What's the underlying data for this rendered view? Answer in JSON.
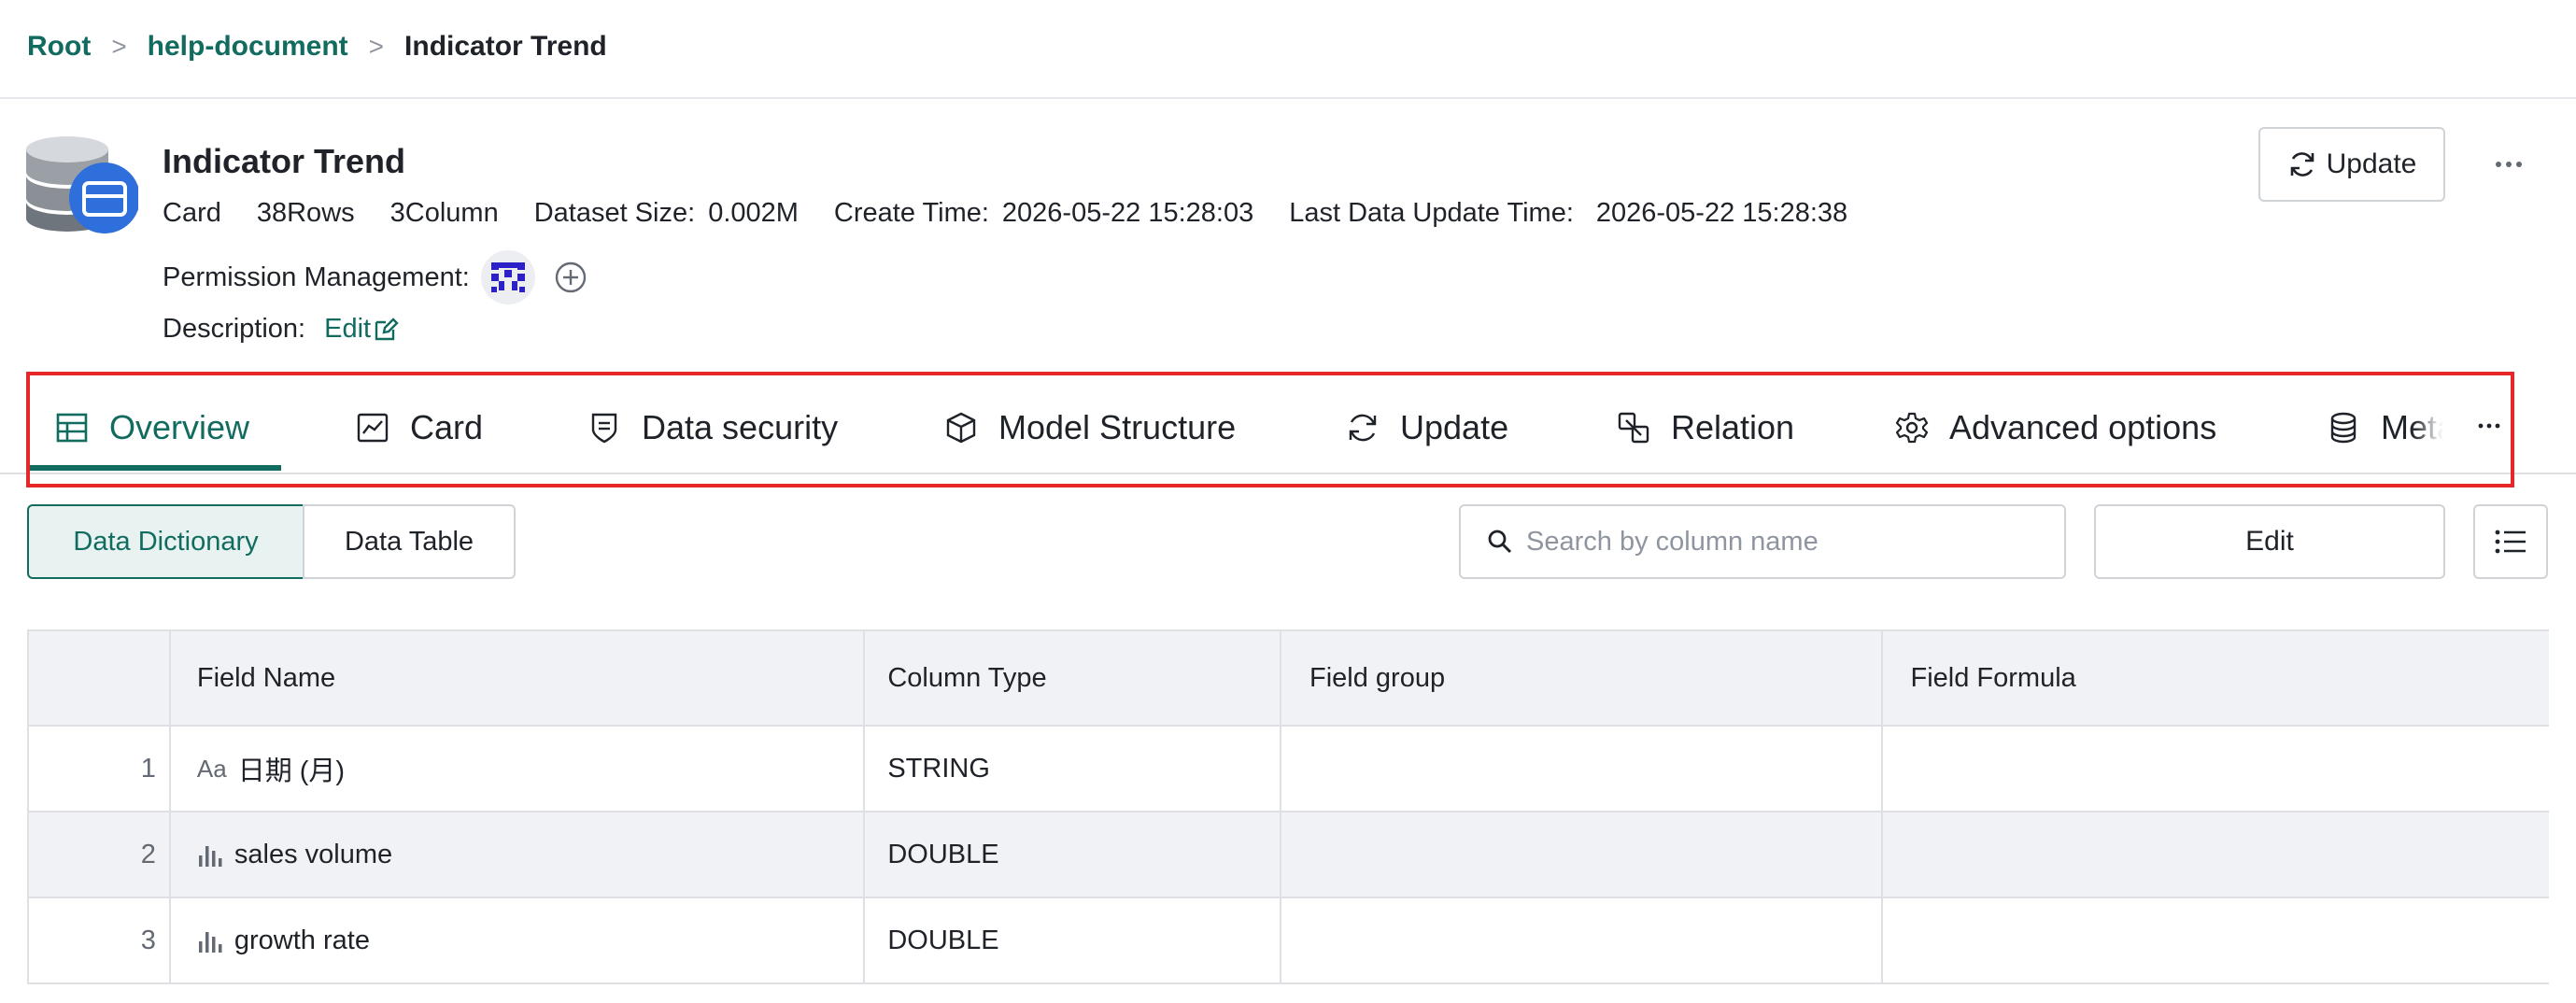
{
  "breadcrumb": {
    "root": "Root",
    "folder": "help-document",
    "current": "Indicator Trend",
    "separator": ">"
  },
  "dataset": {
    "title": "Indicator Trend",
    "kind": "Card",
    "rows": "38Rows",
    "columns": "3Column",
    "size_label": "Dataset Size:",
    "size_value": "0.002M",
    "create_label": "Create Time:",
    "create_value": "2026-05-22 15:28:03",
    "update_label": "Last Data Update Time:",
    "update_value": "2026-05-22 15:28:38",
    "permission_label": "Permission Management:",
    "description_label": "Description:",
    "description_edit": "Edit"
  },
  "header_actions": {
    "update_label": "Update",
    "more_icon": "more-horizontal-icon"
  },
  "tabs": [
    {
      "label": "Overview",
      "icon": "table-icon",
      "active": true
    },
    {
      "label": "Card",
      "icon": "line-chart-icon"
    },
    {
      "label": "Data security",
      "icon": "shield-icon"
    },
    {
      "label": "Model Structure",
      "icon": "cube-icon"
    },
    {
      "label": "Update",
      "icon": "refresh-icon"
    },
    {
      "label": "Relation",
      "icon": "relation-icon"
    },
    {
      "label": "Advanced options",
      "icon": "gear-icon"
    },
    {
      "label": "Metadata",
      "icon": "database-icon"
    }
  ],
  "toolbar": {
    "data_dictionary": "Data Dictionary",
    "data_table": "Data Table",
    "search_placeholder": "Search by column name",
    "edit_label": "Edit"
  },
  "table": {
    "headers": [
      "Field Name",
      "Column Type",
      "Field group",
      "Field Formula"
    ],
    "rows": [
      {
        "index": "1",
        "type_icon": "Aa",
        "name": "日期 (月)",
        "column_type": "STRING",
        "group": "",
        "formula": ""
      },
      {
        "index": "2",
        "type_icon": "bar-chart-icon",
        "name": "sales volume",
        "column_type": "DOUBLE",
        "group": "",
        "formula": ""
      },
      {
        "index": "3",
        "type_icon": "bar-chart-icon",
        "name": "growth rate",
        "column_type": "DOUBLE",
        "group": "",
        "formula": ""
      }
    ]
  },
  "colors": {
    "accent": "#126b5f",
    "highlight_border": "#e5262a",
    "header_bg": "#f1f2f5",
    "avatar": "#2b21c7"
  }
}
